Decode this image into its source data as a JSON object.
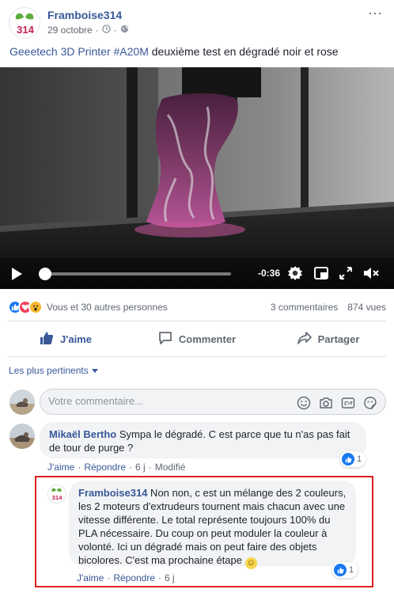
{
  "post": {
    "page_name": "Framboise314",
    "date": "29 octobre",
    "meta_sep": "·",
    "more_label": "···",
    "text_tag_brand": "Geeetech 3D Printer #A20M",
    "text_rest": " deuxième test en dégradé noir et rose"
  },
  "video": {
    "progress_fraction": 0.02,
    "time_remaining": "-0:36",
    "icons": [
      "play-icon",
      "settings-icon",
      "picture-in-picture-icon",
      "fullscreen-icon",
      "volume-muted-icon"
    ]
  },
  "reactions": {
    "icons": [
      "like-reaction-icon",
      "love-reaction-icon",
      "wow-reaction-icon"
    ],
    "summary": "Vous et 30 autres personnes",
    "comments": "3 commentaires",
    "views": "874 vues"
  },
  "actions": {
    "like": "J'aime",
    "comment": "Commenter",
    "share": "Partager"
  },
  "comments_filter": "Les plus pertinents",
  "compose": {
    "placeholder": "Votre commentaire...",
    "icons": [
      "emoji-icon",
      "camera-icon",
      "gif-icon",
      "sticker-icon"
    ]
  },
  "comments": [
    {
      "author": "Mikaël Bertho",
      "text": " Sympa le dégradé. C est parce que tu n'as pas fait de tour de purge ?",
      "like_label": "J'aime",
      "reply_label": "Répondre",
      "age": "6 j",
      "edited": "Modifié",
      "like_count": "1",
      "sep": "·"
    }
  ],
  "reply": {
    "author": "Framboise314",
    "text": " Non non, c est un mélange des 2 couleurs, les 2 moteurs d'extrudeurs tournent mais chacun avec une vitesse différente. Le total représente toujours 100% du PLA nécessaire. Du coup on peut moduler la couleur à volonté. Ici un dégradé mais on peut faire des objets bicolores. C'est ma prochaine étape ",
    "emoji": "☺",
    "like_label": "J'aime",
    "reply_label": "Répondre",
    "age": "6 j",
    "like_count": "1",
    "sep": "·"
  },
  "colors": {
    "link": "#385898",
    "facebook_blue": "#1877f2",
    "highlight_border": "#e02020",
    "print_pink": "#c8589a"
  }
}
